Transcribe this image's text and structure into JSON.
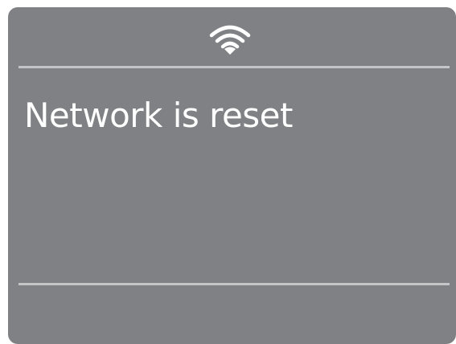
{
  "status_bar": {
    "icon": "wifi-icon",
    "icon_color": "#ffffff"
  },
  "main": {
    "message": "Network is reset"
  },
  "colors": {
    "screen_background": "#808184",
    "divider": "#c4c5c7",
    "text": "#ffffff"
  }
}
